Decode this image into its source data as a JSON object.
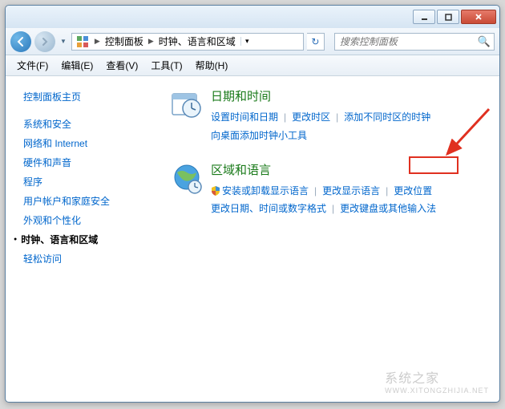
{
  "breadcrumb": {
    "item1": "控制面板",
    "item2": "时钟、语言和区域"
  },
  "search": {
    "placeholder": "搜索控制面板"
  },
  "menubar": {
    "file": "文件(F)",
    "edit": "编辑(E)",
    "view": "查看(V)",
    "tools": "工具(T)",
    "help": "帮助(H)"
  },
  "sidebar": {
    "home": "控制面板主页",
    "items": [
      "系统和安全",
      "网络和 Internet",
      "硬件和声音",
      "程序",
      "用户帐户和家庭安全",
      "外观和个性化",
      "时钟、语言和区域",
      "轻松访问"
    ]
  },
  "categories": [
    {
      "title": "日期和时间",
      "links": [
        {
          "label": "设置时间和日期"
        },
        {
          "label": "更改时区"
        },
        {
          "label": "添加不同时区的时钟"
        },
        {
          "label": "向桌面添加时钟小工具"
        }
      ]
    },
    {
      "title": "区域和语言",
      "links": [
        {
          "label": "安装或卸载显示语言",
          "shield": true
        },
        {
          "label": "更改显示语言"
        },
        {
          "label": "更改位置",
          "highlight": true
        },
        {
          "label": "更改日期、时间或数字格式"
        },
        {
          "label": "更改键盘或其他输入法"
        }
      ]
    }
  ],
  "watermark": {
    "text": "系统之家",
    "url": "WWW.XITONGZHIJIA.NET"
  }
}
